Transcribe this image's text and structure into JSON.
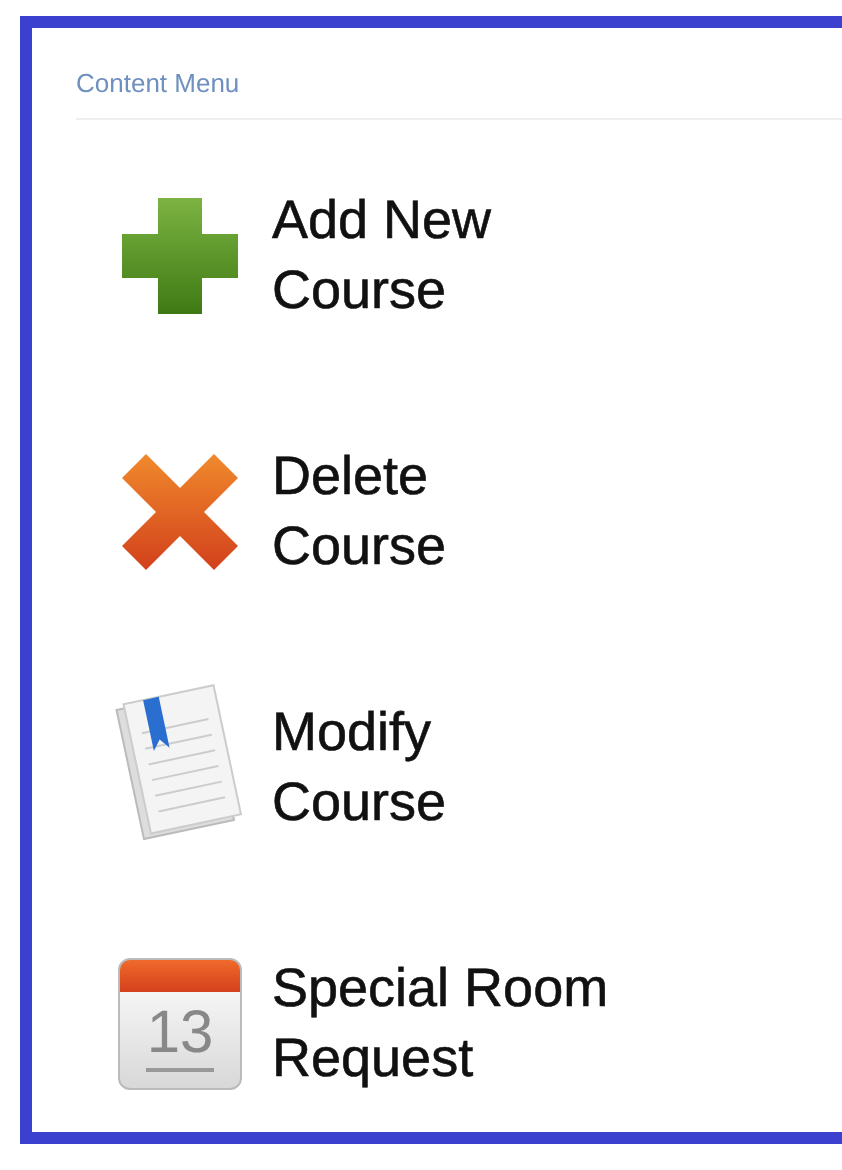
{
  "menu": {
    "title": "Content Menu",
    "items": [
      {
        "kind": "plus",
        "label": "Add New Course"
      },
      {
        "kind": "cross",
        "label": "Delete Course"
      },
      {
        "kind": "document",
        "label": "Modify Course"
      },
      {
        "kind": "calendar",
        "label": "Special Room Request",
        "day": "13"
      }
    ]
  }
}
